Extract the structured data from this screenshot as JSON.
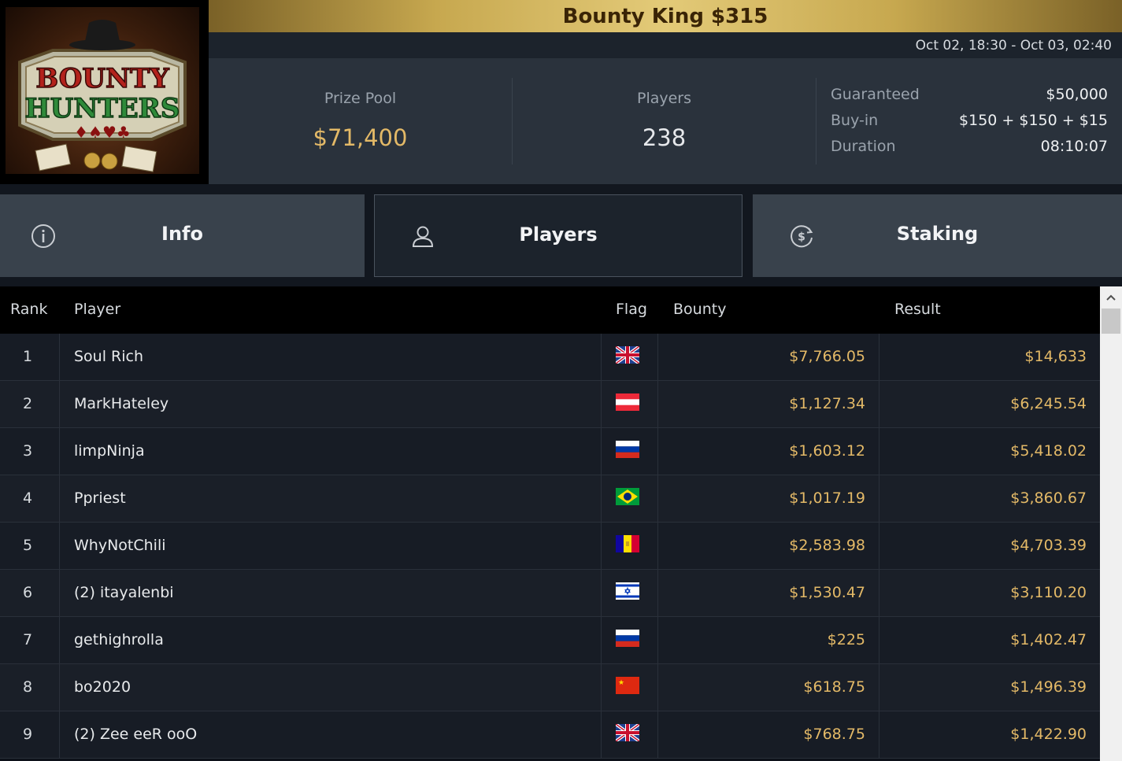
{
  "header": {
    "title": "Bounty King $315",
    "dates": "Oct 02, 18:30 - Oct 03, 02:40"
  },
  "logo": {
    "line1": "BOUNTY",
    "line2": "HUNTERS"
  },
  "stats": {
    "prize_pool_label": "Prize Pool",
    "prize_pool_value": "$71,400",
    "players_label": "Players",
    "players_value": "238"
  },
  "details": {
    "guaranteed_label": "Guaranteed",
    "guaranteed_value": "$50,000",
    "buyin_label": "Buy-in",
    "buyin_value": "$150 + $150 + $15",
    "duration_label": "Duration",
    "duration_value": "08:10:07"
  },
  "tabs": [
    {
      "label": "Info",
      "icon": "info-icon"
    },
    {
      "label": "Players",
      "icon": "user-icon"
    },
    {
      "label": "Staking",
      "icon": "dollar-circle-icon"
    }
  ],
  "active_tab": "Players",
  "table": {
    "headers": {
      "rank": "Rank",
      "player": "Player",
      "flag": "Flag",
      "bounty": "Bounty",
      "result": "Result"
    },
    "rows": [
      {
        "rank": "1",
        "player": "Soul Rich",
        "flag": "uk",
        "bounty": "$7,766.05",
        "result": "$14,633"
      },
      {
        "rank": "2",
        "player": "MarkHateley",
        "flag": "austria",
        "bounty": "$1,127.34",
        "result": "$6,245.54"
      },
      {
        "rank": "3",
        "player": "limpNinja",
        "flag": "russia",
        "bounty": "$1,603.12",
        "result": "$5,418.02"
      },
      {
        "rank": "4",
        "player": "Ppriest",
        "flag": "brazil",
        "bounty": "$1,017.19",
        "result": "$3,860.67"
      },
      {
        "rank": "5",
        "player": "WhyNotChili",
        "flag": "andorra",
        "bounty": "$2,583.98",
        "result": "$4,703.39"
      },
      {
        "rank": "6",
        "player": "(2) itayalenbi",
        "flag": "israel",
        "bounty": "$1,530.47",
        "result": "$3,110.20"
      },
      {
        "rank": "7",
        "player": "gethighrolla",
        "flag": "russia",
        "bounty": "$225",
        "result": "$1,402.47"
      },
      {
        "rank": "8",
        "player": "bo2020",
        "flag": "china",
        "bounty": "$618.75",
        "result": "$1,496.39"
      },
      {
        "rank": "9",
        "player": "(2) Zee eeR ooO",
        "flag": "uk",
        "bounty": "$768.75",
        "result": "$1,422.90"
      }
    ]
  },
  "colors": {
    "accent_gold": "#e3b967",
    "title_gold": "#c7a84f",
    "panel": "#2a323c"
  }
}
